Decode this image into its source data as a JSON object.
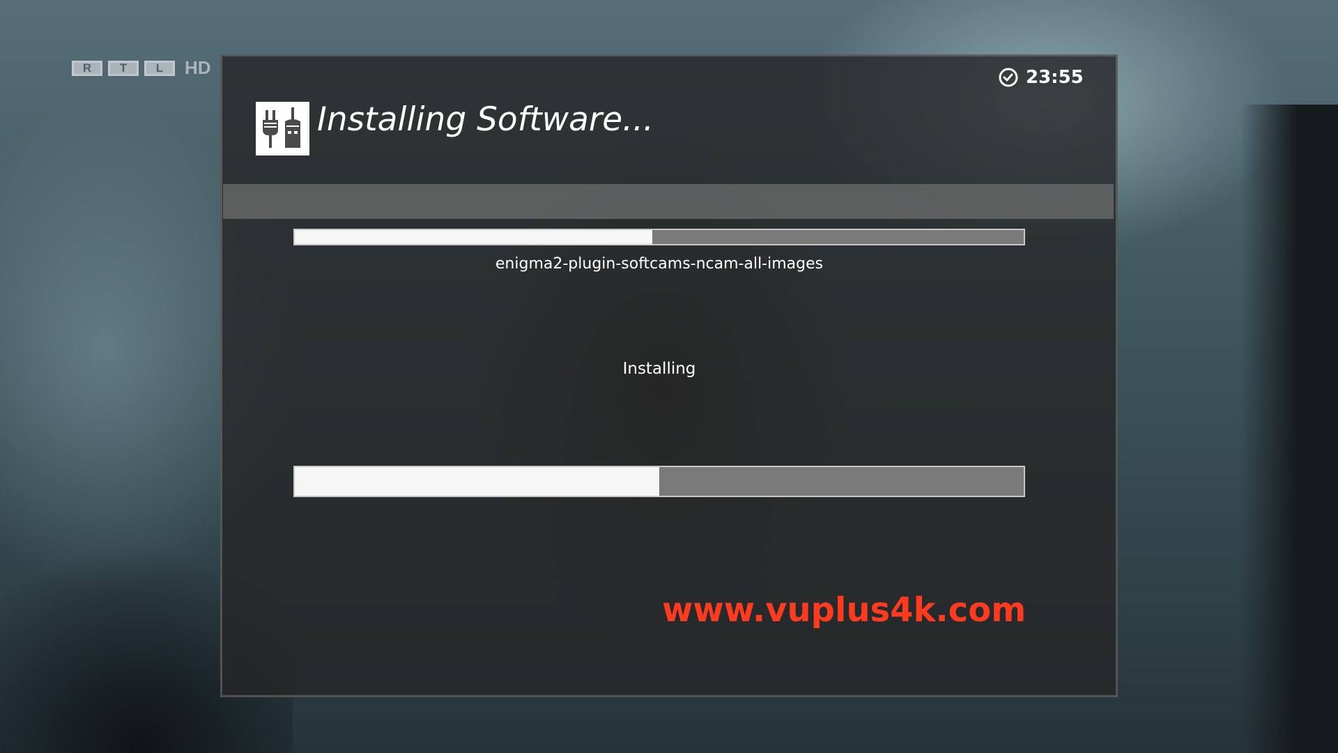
{
  "background": {
    "channel_logo": {
      "letters": [
        "R",
        "T",
        "L"
      ],
      "suffix": "HD"
    }
  },
  "clock": {
    "icon": "clock-icon",
    "time": "23:55"
  },
  "dialog": {
    "icon": "plug-icon",
    "title": "Installing Software...",
    "package_progress": 0.49,
    "package_name": "enigma2-plugin-softcams-ncam-all-images",
    "status": "Installing",
    "total_progress": 0.5
  },
  "watermark": "www.vuplus4k.com",
  "colors": {
    "dialog_bg": "#262626",
    "progress_fill": "#f6f6f6",
    "progress_track": "#7a7a7a",
    "watermark": "#ff3b1f",
    "header_bar": "#6e6e6e"
  }
}
